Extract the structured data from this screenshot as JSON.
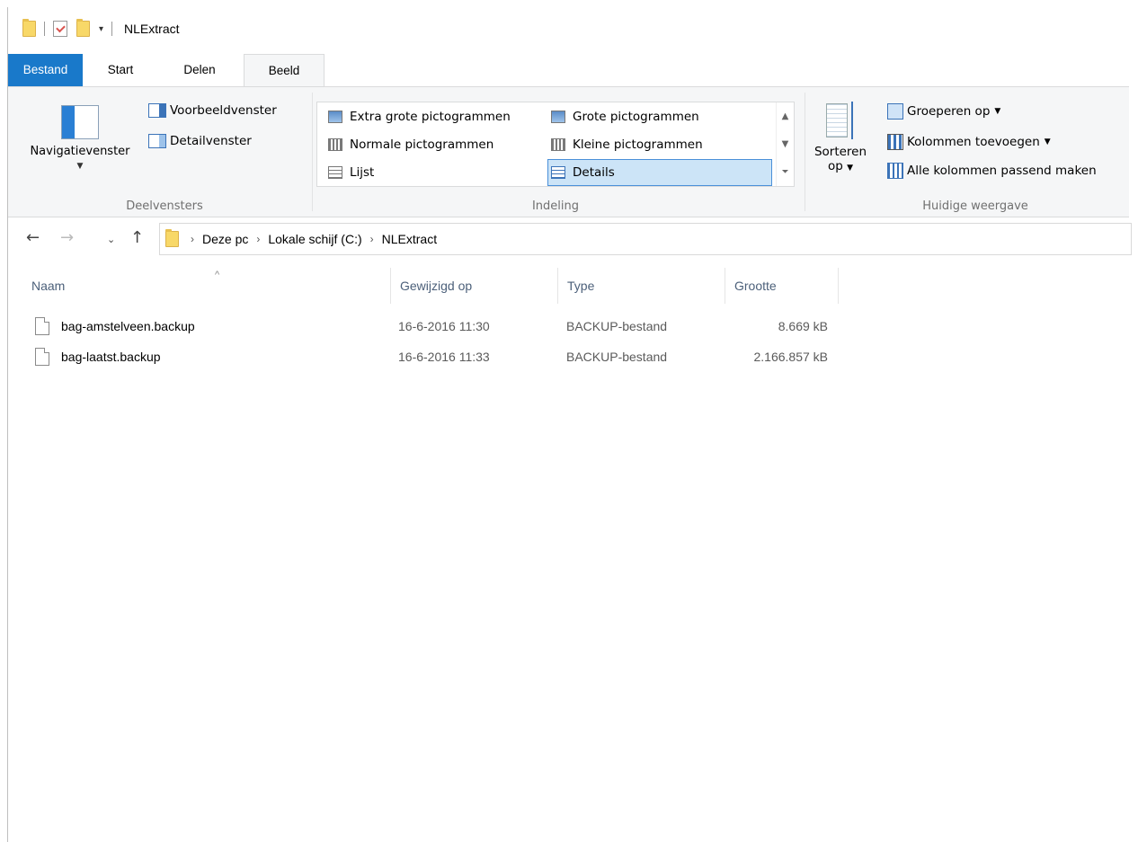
{
  "window": {
    "title": "NLExtract"
  },
  "tabs": {
    "file": "Bestand",
    "start": "Start",
    "share": "Delen",
    "view": "Beeld"
  },
  "ribbon": {
    "panes": {
      "label": "Deelvensters",
      "navigation": "Navigatievenster",
      "preview": "Voorbeeldvenster",
      "details": "Detailvenster"
    },
    "layout": {
      "label": "Indeling",
      "items": [
        "Extra grote pictogrammen",
        "Grote pictogrammen",
        "Normale pictogrammen",
        "Kleine pictogrammen",
        "Lijst",
        "Details"
      ],
      "selected": "Details"
    },
    "current_view": {
      "label": "Huidige weergave",
      "sort_line1": "Sorteren",
      "sort_line2": "op",
      "group_by": "Groeperen op",
      "add_columns": "Kolommen toevoegen",
      "fit_columns": "Alle kolommen passend maken"
    }
  },
  "address": {
    "crumbs": [
      "Deze pc",
      "Lokale schijf (C:)",
      "NLExtract"
    ]
  },
  "columns": {
    "name": "Naam",
    "modified": "Gewijzigd op",
    "type": "Type",
    "size": "Grootte"
  },
  "files": [
    {
      "name": "bag-amstelveen.backup",
      "modified": "16-6-2016 11:30",
      "type": "BACKUP-bestand",
      "size": "8.669 kB"
    },
    {
      "name": "bag-laatst.backup",
      "modified": "16-6-2016 11:33",
      "type": "BACKUP-bestand",
      "size": "2.166.857 kB"
    }
  ],
  "icons": {
    "folder": "folder-icon",
    "properties": "properties-icon",
    "back": "back-arrow-icon",
    "forward": "forward-arrow-icon",
    "recent": "chevron-down-icon",
    "up": "up-arrow-icon",
    "file": "file-icon"
  },
  "colors": {
    "file_tab": "#1979ca",
    "selected_layout": "#cce4f7"
  }
}
